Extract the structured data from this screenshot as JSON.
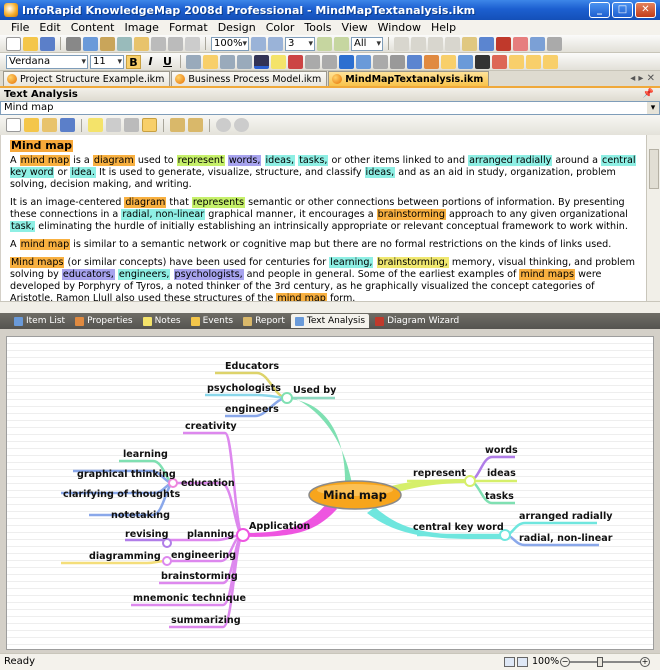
{
  "window": {
    "title": "InfoRapid KnowledgeMap 2008d Professional - MindMapTextanalysis.ikm",
    "buttons": {
      "minimize": "_",
      "maximize": "□",
      "close": "✕"
    }
  },
  "menu": [
    "File",
    "Edit",
    "Content",
    "Image",
    "Format",
    "Design",
    "Color",
    "Tools",
    "View",
    "Window",
    "Help"
  ],
  "toolbar1": {
    "zoom": "100%",
    "depth": "3",
    "filter": "All"
  },
  "toolbar2": {
    "font": "Verdana",
    "size": "11",
    "bold": "B",
    "italic": "I",
    "underline": "U"
  },
  "doc_tabs": [
    {
      "label": "Project Structure Example.ikm",
      "active": false
    },
    {
      "label": "Business Process Model.ikm",
      "active": false
    },
    {
      "label": "MindMapTextanalysis.ikm",
      "active": true
    }
  ],
  "tab_nav": "◂ ▸ ✕",
  "panel": {
    "title": "Text Analysis",
    "pin": "📌",
    "topic": "Mind map"
  },
  "text": {
    "heading": "Mind map",
    "p1": [
      {
        "t": "A "
      },
      {
        "t": "mind map",
        "c": "o"
      },
      {
        "t": " is a "
      },
      {
        "t": "diagram",
        "c": "o"
      },
      {
        "t": " used to "
      },
      {
        "t": "represent",
        "c": "g"
      },
      {
        "t": " "
      },
      {
        "t": "words,",
        "c": "p"
      },
      {
        "t": " "
      },
      {
        "t": "ideas,",
        "c": "c"
      },
      {
        "t": " "
      },
      {
        "t": "tasks,",
        "c": "c"
      },
      {
        "t": " or other items linked to and "
      },
      {
        "t": "arranged radially",
        "c": "c"
      },
      {
        "t": " around a "
      },
      {
        "t": "central key word",
        "c": "c"
      },
      {
        "t": " or "
      },
      {
        "t": "idea.",
        "c": "c"
      },
      {
        "t": " It is used to generate, visualize, structure, and classify "
      },
      {
        "t": "ideas,",
        "c": "c"
      },
      {
        "t": " and as an aid in study, organization, problem solving, decision making, and writing."
      }
    ],
    "p2": [
      {
        "t": "It is an image-centered "
      },
      {
        "t": "diagram",
        "c": "o"
      },
      {
        "t": " that "
      },
      {
        "t": "represents",
        "c": "g"
      },
      {
        "t": " semantic or other connections between portions of information. By presenting these connections in a "
      },
      {
        "t": "radial, non-linear",
        "c": "c"
      },
      {
        "t": " graphical manner, it encourages a "
      },
      {
        "t": "brainstorming",
        "c": "o"
      },
      {
        "t": " approach to any given organizational "
      },
      {
        "t": "task,",
        "c": "c"
      },
      {
        "t": " eliminating the hurdle of initially establishing an intrinsically appropriate or relevant conceptual framework to work within."
      }
    ],
    "p3": [
      {
        "t": "A "
      },
      {
        "t": "mind map",
        "c": "o"
      },
      {
        "t": " is similar to a semantic network or cognitive map but there are no formal restrictions on the kinds of links used."
      }
    ],
    "p4": [
      {
        "t": "Mind maps",
        "c": "o"
      },
      {
        "t": " (or similar concepts) have been used for centuries for "
      },
      {
        "t": "learning,",
        "c": "c"
      },
      {
        "t": " "
      },
      {
        "t": "brainstorming,",
        "c": "yl"
      },
      {
        "t": " memory, visual thinking, and problem solving by "
      },
      {
        "t": "educators,",
        "c": "p"
      },
      {
        "t": " "
      },
      {
        "t": "engineers,",
        "c": "c"
      },
      {
        "t": " "
      },
      {
        "t": "psychologists,",
        "c": "p"
      },
      {
        "t": " and people in general. Some of the earliest examples of "
      },
      {
        "t": "mind maps",
        "c": "o"
      },
      {
        "t": " were developed by Porphyry of Tyros, a noted thinker of the 3rd century, as he graphically visualized the concept categories of Aristotle. Ramon Llull also used these structures of the "
      },
      {
        "t": "mind map",
        "c": "o"
      },
      {
        "t": " form."
      }
    ]
  },
  "bottom_tabs": [
    {
      "label": "Item List",
      "active": false
    },
    {
      "label": "Properties",
      "active": false
    },
    {
      "label": "Notes",
      "active": false
    },
    {
      "label": "Events",
      "active": false
    },
    {
      "label": "Report",
      "active": false
    },
    {
      "label": "Text Analysis",
      "active": true
    },
    {
      "label": "Diagram Wizard",
      "active": false
    }
  ],
  "mindmap": {
    "center": "Mind map",
    "branches": {
      "used_by": "Used by",
      "used_by_items": [
        "Educators",
        "psychologists",
        "engineers"
      ],
      "represent": "represent",
      "represent_items": [
        "words",
        "ideas",
        "tasks"
      ],
      "central_key_word": "central key word",
      "ckw_items": [
        "arranged radially",
        "radial, non-linear"
      ],
      "application": "Application",
      "creativity": "creativity",
      "education": "education",
      "education_items": [
        "learning",
        "graphical thinking",
        "clarifying of thoughts",
        "notetaking"
      ],
      "planning": "planning",
      "revising": "revising",
      "engineering": "engineering",
      "diagramming": "diagramming",
      "brainstorming": "brainstorming",
      "mnemonic_technique": "mnemonic technique",
      "summarizing": "summarizing"
    }
  },
  "status": {
    "text": "Ready",
    "zoom": "100%"
  },
  "colors": {
    "title_bar": "#1c5fd0",
    "center_node": "#f7a51c",
    "used_by_branch": "#7fe0b2",
    "represent_branch": "#d6ef6a",
    "ckw_branch": "#6fe6de",
    "application_branch": "#ee55e0"
  }
}
